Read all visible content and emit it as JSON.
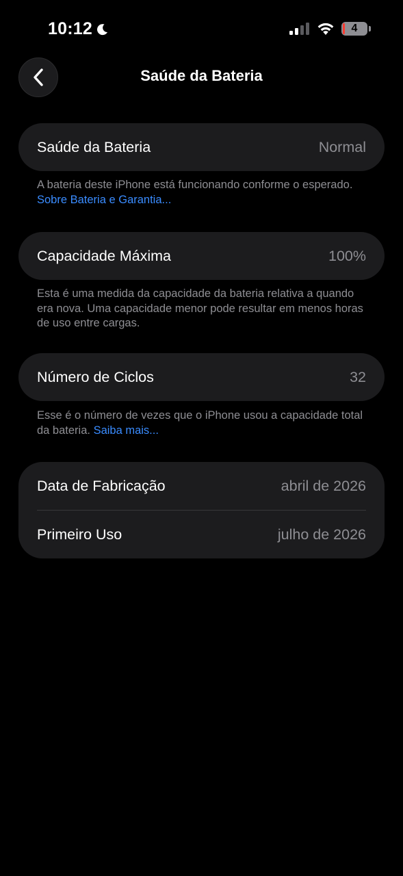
{
  "status_bar": {
    "time": "10:12",
    "battery_level": "4",
    "battery_fraction": 0.04
  },
  "nav": {
    "title": "Saúde da Bateria",
    "back_icon": "chevron-left-icon"
  },
  "battery_health": {
    "label": "Saúde da Bateria",
    "value": "Normal",
    "footnote_text": "A bateria deste iPhone está funcionando conforme o esperado. ",
    "footnote_link": "Sobre Bateria e Garantia..."
  },
  "max_capacity": {
    "label": "Capacidade Máxima",
    "value": "100%",
    "footnote_text": "Esta é uma medida da capacidade da bateria relativa a quando era nova. Uma capacidade menor pode resultar em menos horas de uso entre cargas."
  },
  "cycle_count": {
    "label": "Número de Ciclos",
    "value": "32",
    "footnote_text": "Esse é o número de vezes que o iPhone usou a capacidade total da bateria. ",
    "footnote_link": "Saiba mais..."
  },
  "dates": {
    "manufacture_label": "Data de Fabricação",
    "manufacture_value": "abril de 2026",
    "first_use_label": "Primeiro Uso",
    "first_use_value": "julho de 2026"
  },
  "colors": {
    "background": "#000000",
    "card": "#1c1c1e",
    "secondary_text": "#8e8e93",
    "link": "#3a8cff",
    "battery_low": "#ff3b30"
  }
}
